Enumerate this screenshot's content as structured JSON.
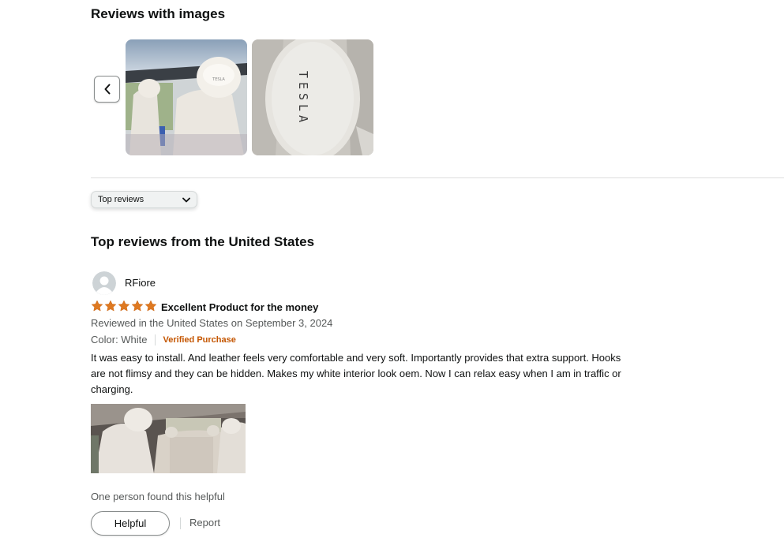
{
  "images_section": {
    "title": "Reviews with images",
    "prev_icon": "chevron-left-icon",
    "thumbnails": [
      {
        "label": "TESLA"
      },
      {
        "label": "TESLA"
      }
    ]
  },
  "sort": {
    "selected": "Top reviews",
    "icon": "chevron-down-icon"
  },
  "reviews_heading": "Top reviews from the United States",
  "review": {
    "reviewer": "RFiore",
    "avatar_icon": "user-avatar-icon",
    "rating": 5,
    "rating_max": 5,
    "star_color": "#de7921",
    "title": "Excellent Product for the money",
    "date": "Reviewed in the United States on September 3, 2024",
    "color_label": "Color: White",
    "verified": "Verified Purchase",
    "body": "It was easy to install. And leather feels very comfortable and very soft. Importantly provides that extra support. Hooks are not flimsy and they can be hidden. Makes my white interior look oem. Now I can relax easy when I am in traffic or charging.",
    "helpful_count": "One person found this helpful",
    "helpful_label": "Helpful",
    "report_label": "Report"
  },
  "colors": {
    "verified": "#c45500",
    "secondary_text": "#565959",
    "primary_text": "#0f1111"
  }
}
